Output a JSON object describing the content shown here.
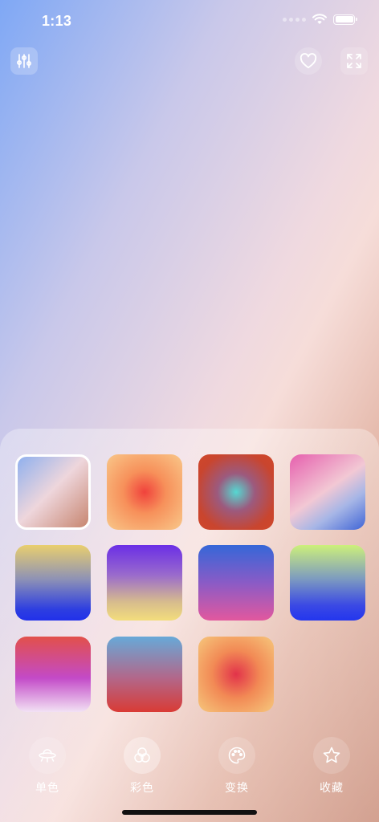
{
  "status": {
    "time": "1:13"
  },
  "swatches": [
    {
      "id": "s1",
      "selected": true
    },
    {
      "id": "s2"
    },
    {
      "id": "s3"
    },
    {
      "id": "s4"
    },
    {
      "id": "s5"
    },
    {
      "id": "s6"
    },
    {
      "id": "s7"
    },
    {
      "id": "s8"
    },
    {
      "id": "s9"
    },
    {
      "id": "s10"
    },
    {
      "id": "s11"
    }
  ],
  "nav": {
    "solid": "单色",
    "color": "彩色",
    "transform": "变换",
    "favorites": "收藏"
  },
  "icons": {
    "settings": "sliders-icon",
    "favorite": "heart-icon",
    "fullscreen": "expand-icon"
  }
}
